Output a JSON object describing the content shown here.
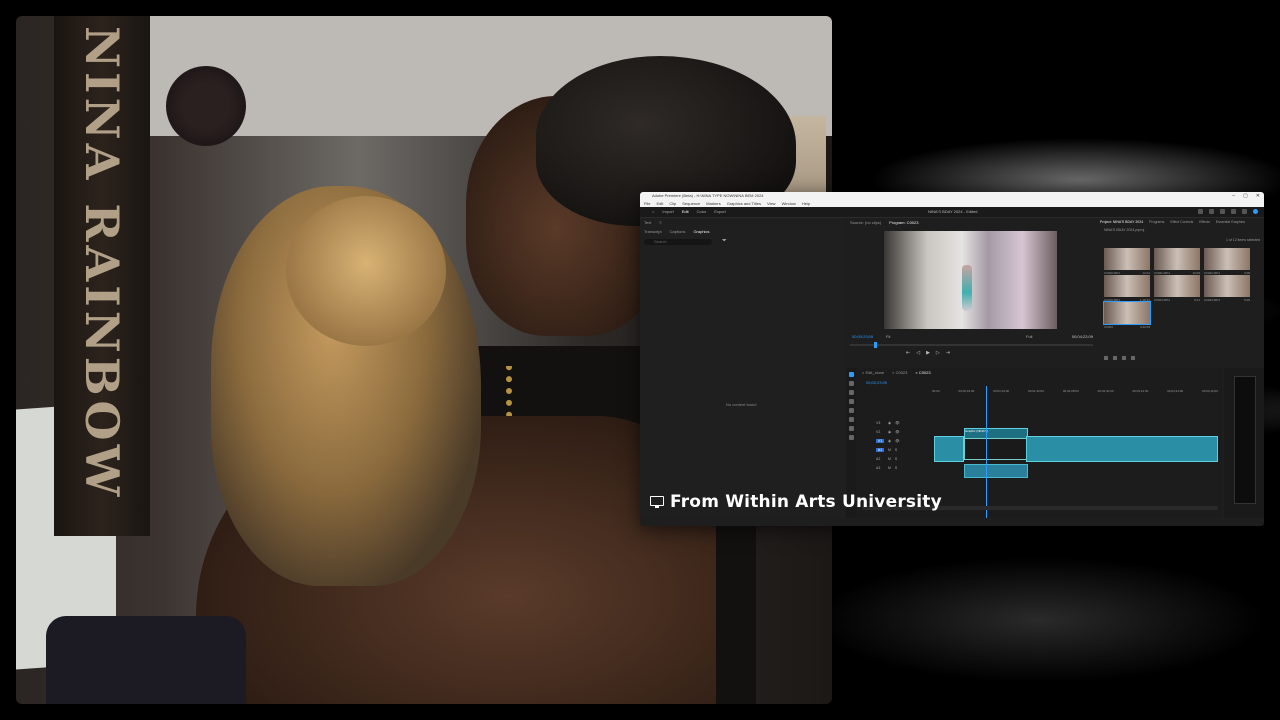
{
  "photo": {
    "banner_text": "NINA RAINBOW"
  },
  "premiere": {
    "title": "Adobe Premiere (Beta) - H:\\NINA TYPE NOW\\NINA BEM 2024",
    "window_controls": [
      "–",
      "▢",
      "✕"
    ],
    "menu": [
      "File",
      "Edit",
      "Clip",
      "Sequence",
      "Markers",
      "Graphics and Titles",
      "View",
      "Window",
      "Help"
    ],
    "workspace_tabs": [
      "Import",
      "Edit",
      "Color",
      "Export"
    ],
    "workspace_active": "Edit",
    "project_title": "NINA'S BDAY 2024 - Edited",
    "left_tabs": [
      "Text",
      "≡"
    ],
    "left_subtabs": [
      "Transcript",
      "Captions",
      "Graphics"
    ],
    "left_subtab_active": "Graphics",
    "search_placeholder": "Search",
    "no_content": "No content found",
    "monitor_tabs": [
      "Source: (no clips)",
      "Program: C0023"
    ],
    "monitor_active": "Program: C0023",
    "timecode_left": "00;00;23;09",
    "timecode_right": "00;04;22;09",
    "fit": "Fit",
    "full": "Full",
    "transport": [
      "⇤",
      "◁",
      "▶",
      "▷",
      "⇥"
    ],
    "project_tabs": [
      "Project: NINA'S BDAY 2024",
      "Programs",
      "Effect Controls",
      "Effects",
      "Essential Graphics"
    ],
    "project_path": "NINA'S BDAY 2024.prproj",
    "project_count": "1 of 12 items selected",
    "thumbs": [
      {
        "label": "C0020.MP4",
        "dur": "12;01"
      },
      {
        "label": "C0021.MP4",
        "dur": "10;09"
      },
      {
        "label": "C0022.MP4",
        "dur": "3;08"
      },
      {
        "label": "C0019.MP4",
        "dur": "1;18;22"
      },
      {
        "label": "C0023.MP4",
        "dur": "9;21"
      },
      {
        "label": "C0024.MP4",
        "dur": "5;09"
      },
      {
        "label": "C0023",
        "dur": "4;22;09"
      }
    ],
    "timeline_tabs": [
      "× Edit_clone",
      "× C0023",
      "× C0023"
    ],
    "seq_name": "00;00;23;09",
    "ruler": [
      "00;00",
      "00;00;32;00",
      "00;01;04;00",
      "00;01;36;00",
      "00;02;08;00",
      "00;02;40;00",
      "00;03;12;00",
      "00;03;44;00",
      "00;04;16;00"
    ],
    "tracks": [
      "V3",
      "V2",
      "V1",
      "A1",
      "A2",
      "A3"
    ],
    "clip_title": "Graphic (NINA'S)"
  },
  "caption": {
    "text": "From Within Arts University"
  }
}
